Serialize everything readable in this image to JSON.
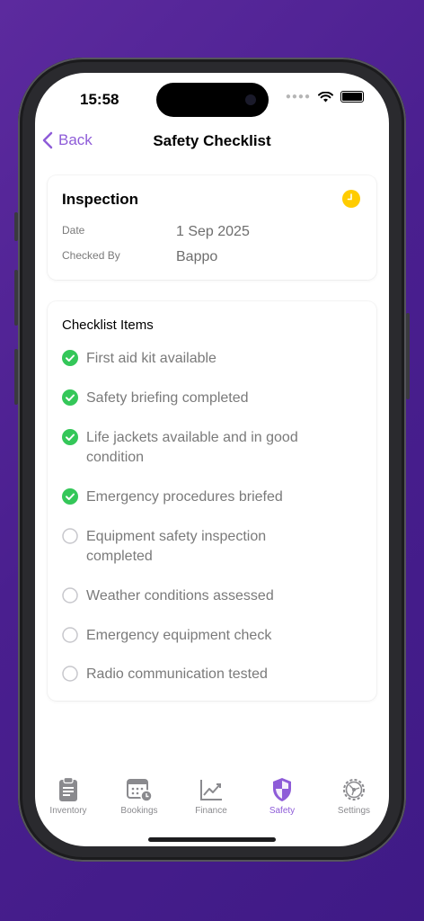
{
  "status": {
    "time": "15:58"
  },
  "nav": {
    "back_label": "Back",
    "title": "Safety Checklist"
  },
  "inspection": {
    "title": "Inspection",
    "status_icon": "clock-icon",
    "status_color": "#ffcc00",
    "date_label": "Date",
    "date_value": "1 Sep 2025",
    "checked_by_label": "Checked By",
    "checked_by_value": "Bappo"
  },
  "checklist": {
    "title": "Checklist Items",
    "checked_color": "#34c759",
    "items": [
      {
        "label": "First aid kit available",
        "checked": true
      },
      {
        "label": "Safety briefing completed",
        "checked": true
      },
      {
        "label": "Life jackets available and in good condition",
        "checked": true
      },
      {
        "label": "Emergency procedures briefed",
        "checked": true
      },
      {
        "label": "Equipment safety inspection completed",
        "checked": false
      },
      {
        "label": "Weather conditions assessed",
        "checked": false
      },
      {
        "label": "Emergency equipment check",
        "checked": false
      },
      {
        "label": "Radio communication tested",
        "checked": false
      }
    ]
  },
  "tabs": [
    {
      "label": "Inventory",
      "icon": "clipboard-icon",
      "active": false
    },
    {
      "label": "Bookings",
      "icon": "calendar-icon",
      "active": false
    },
    {
      "label": "Finance",
      "icon": "chart-icon",
      "active": false
    },
    {
      "label": "Safety",
      "icon": "shield-icon",
      "active": true
    },
    {
      "label": "Settings",
      "icon": "gear-icon",
      "active": false
    }
  ],
  "accent_color": "#8e5cd8"
}
